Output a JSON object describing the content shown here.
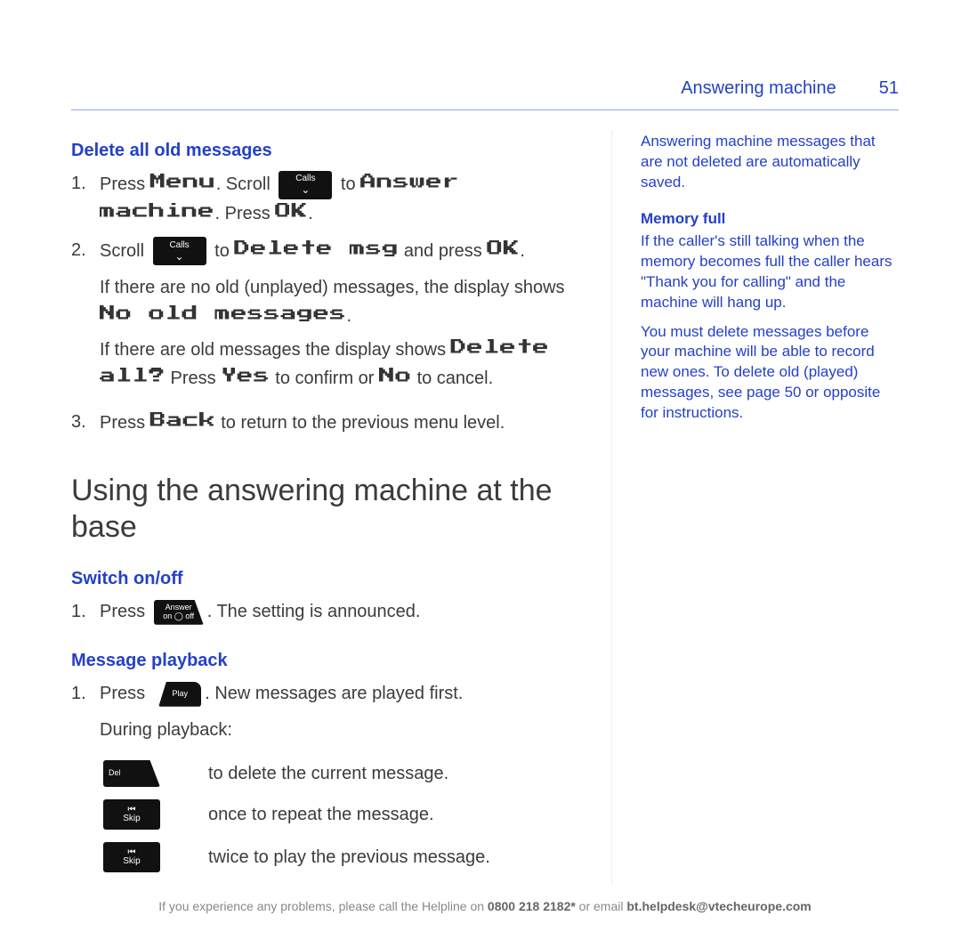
{
  "header": {
    "section_title": "Answering machine",
    "page_number": "51"
  },
  "main": {
    "h_delete": "Delete all old messages",
    "step1": {
      "no": "1.",
      "t1": "Press ",
      "menu": "Menu",
      "t2": ". Scroll ",
      "t3": " to ",
      "ans_machine": "Answer machine",
      "t4": ". Press ",
      "ok1": "OK",
      "t5": "."
    },
    "step2": {
      "no": "2.",
      "t1": "Scroll ",
      "t2": " to ",
      "delete_msg": "Delete msg",
      "t3": " and press ",
      "ok": "OK",
      "t4": "."
    },
    "para_no_old_a": "If there are no old (unplayed) messages, the display shows ",
    "no_old": "No old messages",
    "para_no_old_b": ".",
    "para_old_a": "If there are old messages the display shows ",
    "delete_all": "Delete all?",
    "para_old_b": " Press ",
    "yes": "Yes",
    "para_old_c": " to confirm or ",
    "no": "No",
    "para_old_d": " to cancel.",
    "step3": {
      "no": "3.",
      "t1": "Press ",
      "back": "Back",
      "t2": " to return to the previous menu level."
    },
    "h_base": "Using the answering machine at the base",
    "h_switch": "Switch on/off",
    "switch_step1": {
      "no": "1.",
      "t1": "Press ",
      "t2": ". The setting is announced."
    },
    "h_playback": "Message playback",
    "play_step1": {
      "no": "1.",
      "t1": "Press ",
      "t2": ". New messages are played first."
    },
    "during": "During playback:",
    "pb_rows": [
      {
        "desc": "to delete the current message."
      },
      {
        "desc": "once to repeat the message."
      },
      {
        "desc": "twice to play the previous message."
      }
    ],
    "keys": {
      "calls": "Calls",
      "answer_top": "Answer",
      "answer_on": "on",
      "answer_off": "off",
      "play": "Play",
      "del": "Del",
      "skip": "Skip"
    }
  },
  "side": {
    "p1": "Answering machine messages that are not deleted are automatically saved.",
    "h_memory": "Memory full",
    "p2": "If the caller's still talking when the memory becomes full the caller hears \"Thank you for calling\" and the machine will hang up.",
    "p3": "You must delete messages before your machine will be able to record new ones. To delete old (played) messages, see page 50 or opposite for instructions."
  },
  "footer": {
    "t1": "If you experience any problems, please call the Helpline on ",
    "phone": "0800 218 2182*",
    "t2": " or email ",
    "email": "bt.helpdesk@vtecheurope.com"
  }
}
